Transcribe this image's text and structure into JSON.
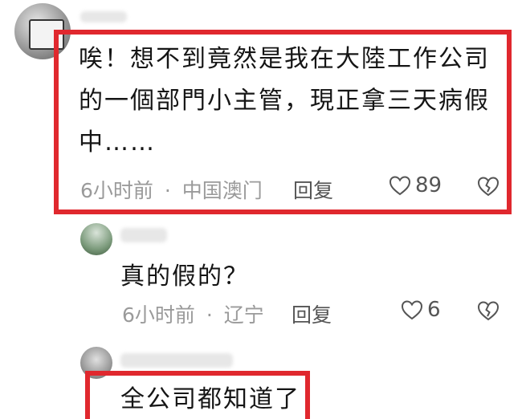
{
  "comments": [
    {
      "text": "唉！想不到竟然是我在大陸工作公司的一個部門小主管，現正拿三天病假中……",
      "time": "6小时前",
      "location": "中国澳门",
      "reply_label": "回复",
      "likes": "89",
      "highlighted": true
    },
    {
      "text": "真的假的？",
      "time": "6小时前",
      "location": "辽宁",
      "reply_label": "回复",
      "likes": "6",
      "highlighted": false
    },
    {
      "text": "全公司都知道了",
      "highlighted": true
    }
  ],
  "meta_separator": "·",
  "icons": {
    "like": "heart-outline-icon",
    "dislike": "broken-heart-icon"
  },
  "colors": {
    "highlight": "#e0282e",
    "meta": "#9a9a9a",
    "text": "#151515"
  }
}
